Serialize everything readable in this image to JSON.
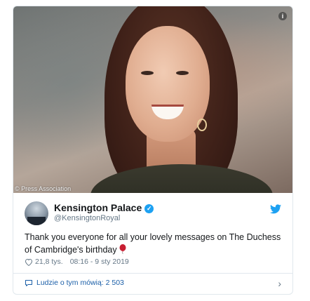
{
  "photo": {
    "credit": "© Press Association",
    "info_icon": "info-icon"
  },
  "tweet": {
    "author_name": "Kensington Palace",
    "author_handle": "@KensingtonRoyal",
    "text": "Thank you everyone for all your lovely messages on The Duchess of Cambridge's birthday",
    "likes": "21,8 tys.",
    "timestamp": "08:16 - 9 sty 2019",
    "people_talking": "Ludzie o tym mówią: 2 503"
  },
  "colors": {
    "twitter_blue": "#1da1f2",
    "link_blue": "#1b5fa8",
    "meta_gray": "#657786",
    "balloon_red": "#c81e32"
  }
}
